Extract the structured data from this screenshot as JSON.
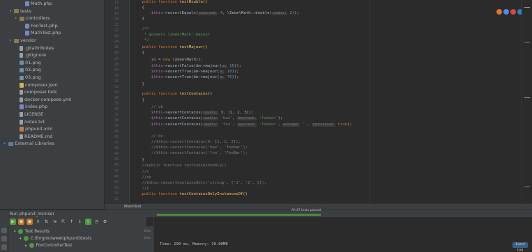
{
  "project_tree": {
    "items": [
      {
        "label": "Math.php",
        "icon": "php-file-icon",
        "indent": 3,
        "arrow": ""
      },
      {
        "label": "tests",
        "icon": "folder-icon",
        "indent": 1,
        "arrow": "▾"
      },
      {
        "label": "controllers",
        "icon": "folder-icon",
        "indent": 2,
        "arrow": "▸"
      },
      {
        "label": "FooTest.php",
        "icon": "php-file-icon",
        "indent": 3,
        "arrow": ""
      },
      {
        "label": "MathTest.php",
        "icon": "php-file-icon",
        "indent": 3,
        "arrow": ""
      },
      {
        "label": "vendor",
        "icon": "folder-icon",
        "indent": 1,
        "arrow": "▸"
      },
      {
        "label": ".gitattributes",
        "icon": "file-icon",
        "indent": 2,
        "arrow": ""
      },
      {
        "label": ".gitignore",
        "icon": "file-icon",
        "indent": 2,
        "arrow": ""
      },
      {
        "label": "01.png",
        "icon": "image-file-icon",
        "indent": 2,
        "arrow": ""
      },
      {
        "label": "02.png",
        "icon": "image-file-icon",
        "indent": 2,
        "arrow": ""
      },
      {
        "label": "03.png",
        "icon": "image-file-icon",
        "indent": 2,
        "arrow": ""
      },
      {
        "label": "composer.json",
        "icon": "json-file-icon",
        "indent": 2,
        "arrow": ""
      },
      {
        "label": "composer.lock",
        "icon": "file-icon",
        "indent": 2,
        "arrow": ""
      },
      {
        "label": "docker-compose.yml",
        "icon": "file-icon",
        "indent": 2,
        "arrow": ""
      },
      {
        "label": "index.php",
        "icon": "php-file-icon",
        "indent": 2,
        "arrow": ""
      },
      {
        "label": "LICENSE",
        "icon": "file-icon",
        "indent": 2,
        "arrow": ""
      },
      {
        "label": "notes.txt",
        "icon": "file-icon",
        "indent": 2,
        "arrow": ""
      },
      {
        "label": "phpunit.xml",
        "icon": "xml-file-icon",
        "indent": 2,
        "arrow": ""
      },
      {
        "label": "README.md",
        "icon": "file-icon",
        "indent": 2,
        "arrow": ""
      },
      {
        "label": "External Libraries",
        "icon": "library-icon",
        "indent": 0,
        "arrow": "▸"
      }
    ]
  },
  "editor": {
    "line_numbers": [
      "17",
      "18",
      "19",
      "20",
      "21",
      "22",
      "23",
      "24",
      "25",
      "26",
      "27",
      "28",
      "29",
      "30",
      "31",
      "32",
      "33",
      "34",
      "35",
      "36",
      "37",
      "38",
      "39",
      "40",
      "41",
      "42",
      "43",
      "44",
      "45",
      "46",
      "47",
      "48",
      "49",
      "50",
      "51",
      "52"
    ],
    "code": {
      "l1_kw": "public function ",
      "l1_fn": "testDouble()",
      "l2": "{",
      "l3_var": "$this",
      "l3_a": "->assertEquals(",
      "l3_hint": "expected:",
      "l3_num": " 4",
      "l3_b": ", \\Zeee\\Math::double(",
      "l3_hint2": "number:",
      "l3_num2": " 2",
      "l3_c": "));",
      "l4": "}",
      "l5_doc": "/**",
      "l6_doc": " * @covers \\Zeee\\Math::majeur",
      "l7_doc": " */",
      "l8_kw": "public function ",
      "l8_fn": "testMajeur()",
      "l9": "{",
      "l10_var": "$m",
      "l10_a": " = ",
      "l10_kw": "new",
      "l10_b": " \\Zeee\\Math();",
      "l11_var": "$this",
      "l11_a": "->assertFalse($m->majeur(",
      "l11_hint": "a:",
      "l11_num": " 15",
      "l11_b": "));",
      "l12_var": "$this",
      "l12_a": "->assertTrue($m->majeur(",
      "l12_hint": "a:",
      "l12_num": " 18",
      "l12_b": "));",
      "l13_var": "$this",
      "l13_a": "->assertTrue($m->majeur(",
      "l13_hint": "a:",
      "l13_num": " 75",
      "l13_b": "));",
      "l14": "}",
      "l15_kw": "public function ",
      "l15_fn": "testContains()",
      "l16": "{",
      "l17_cmt": "// ok",
      "l18_var": "$this",
      "l18_a": "->assertContains(",
      "l18_hint": "needle:",
      "l18_b": " 3, [1, 2, 3]);",
      "l19_var": "$this",
      "l19_a": "->assertContains(",
      "l19_hint": "needle:",
      "l19_str": " 'baz'",
      "l19_b": ", ",
      "l19_hint2": "haystack:",
      "l19_str2": " 'foobar'",
      "l19_c": ");",
      "l20_var": "$this",
      "l20_a": "->assertContains(",
      "l20_hint": "needle:",
      "l20_str": " 'foo'",
      "l20_b": ", ",
      "l20_hint2": "haystack:",
      "l20_str2": " 'foobar'",
      "l20_c": ", ",
      "l20_hint3": "message:",
      "l20_str3": " ''",
      "l20_d": ", ",
      "l20_hint4": "ignoreCase:",
      "l20_kw": " true",
      "l20_e": ");",
      "l21_cmt": "// ko",
      "l22_cmt": "//$this->assertContains(4, [1, 2, 3]);",
      "l23_cmt": "//$this->assertContains('baz', 'foobar');",
      "l24_cmt": "//$this->assertContains('foo', 'FooBar');",
      "l25": "}",
      "l26_cmt": "//public function testContainsOnly()",
      "l27_cmt": "//{",
      "l28_cmt": "//ok",
      "l29_cmt": "//$this->assertContainsOnly('string', ['1', '2', 3]);",
      "l30_cmt": "//}",
      "l31_kw": "public function ",
      "l31_fn": "testContainsOnlyInstancesOf()"
    }
  },
  "breadcrumb": {
    "label": "MathTest"
  },
  "run_panel": {
    "run_label": "Run",
    "config_name": "phpunit_mcinser",
    "progress_text": "All 47 tests passed",
    "progress_fraction": 1.0,
    "results": [
      {
        "label": "Test Results",
        "time": "2ms",
        "indent": 1,
        "arrow": "▾"
      },
      {
        "label": "C:\\forgion\\www\\phpunit\\tests",
        "time": "2ms",
        "indent": 2,
        "arrow": "▾"
      },
      {
        "label": "FooControllerTest",
        "time": "",
        "indent": 3,
        "arrow": "▸"
      }
    ],
    "console_output": "Time: 290 ms, Memory: 10.00MB",
    "log_button": "Event Log"
  },
  "colors": {
    "background": "#2b2b2b",
    "panel": "#3c3f41",
    "keyword": "#cc7832",
    "function": "#ffc66d",
    "variable": "#9876aa",
    "string": "#6a8759",
    "number": "#6897bb",
    "comment": "#808080",
    "success": "#4e9a3d"
  }
}
